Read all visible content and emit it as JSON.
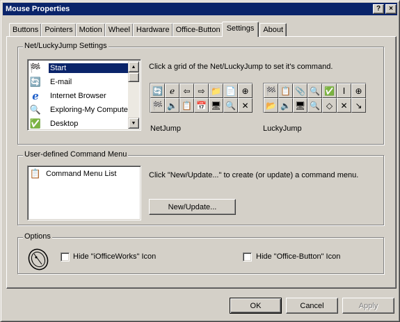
{
  "window": {
    "title": "Mouse Properties",
    "help_glyph": "?",
    "close_glyph": "×"
  },
  "tabs": [
    {
      "label": "Buttons"
    },
    {
      "label": "Pointers"
    },
    {
      "label": "Motion"
    },
    {
      "label": "Wheel"
    },
    {
      "label": "Hardware"
    },
    {
      "label": "Office-Button"
    },
    {
      "label": "Settings"
    },
    {
      "label": "About"
    }
  ],
  "active_tab": "Settings",
  "netlucky": {
    "group_label": "Net/LuckyJump Settings",
    "instruction": "Click a grid of the Net/LuckyJump to set it's command.",
    "list": [
      {
        "label": "Start",
        "icon": "start-icon",
        "selected": true
      },
      {
        "label": "E-mail",
        "icon": "email-icon"
      },
      {
        "label": "Internet Browser",
        "icon": "internet-explorer-icon"
      },
      {
        "label": "Exploring-My Computer",
        "icon": "explore-computer-icon"
      },
      {
        "label": "Desktop",
        "icon": "desktop-icon"
      }
    ],
    "netjump_label": "NetJump",
    "luckyjump_label": "LuckyJump",
    "netjump_grid": [
      "🔄",
      "ℯ",
      "⇦",
      "⇨",
      "📁",
      "📄",
      "⊕",
      "🏁",
      "🔈",
      "📋",
      "📅",
      "🖥",
      "🔍",
      "✕"
    ],
    "luckyjump_grid": [
      "🏁",
      "📋",
      "📎",
      "🔍",
      "✅",
      "Ⅰ",
      "⊕",
      "📂",
      "🔈",
      "🖥",
      "🔍",
      "◇",
      "✕",
      "↘"
    ]
  },
  "user_menu": {
    "group_label": "User-defined Command Menu",
    "list": [
      {
        "label": "Command Menu List",
        "icon": "command-menu-list-icon"
      }
    ],
    "instruction": "Click \"New/Update...\" to create (or update) a command menu.",
    "new_update_button": "New/Update..."
  },
  "options": {
    "group_label": "Options",
    "hide_iofficeworks": "Hide \"iOfficeWorks\" Icon",
    "hide_officebutton": "Hide \"Office-Button\" Icon"
  },
  "buttons": {
    "ok": "OK",
    "cancel": "Cancel",
    "apply": "Apply"
  }
}
